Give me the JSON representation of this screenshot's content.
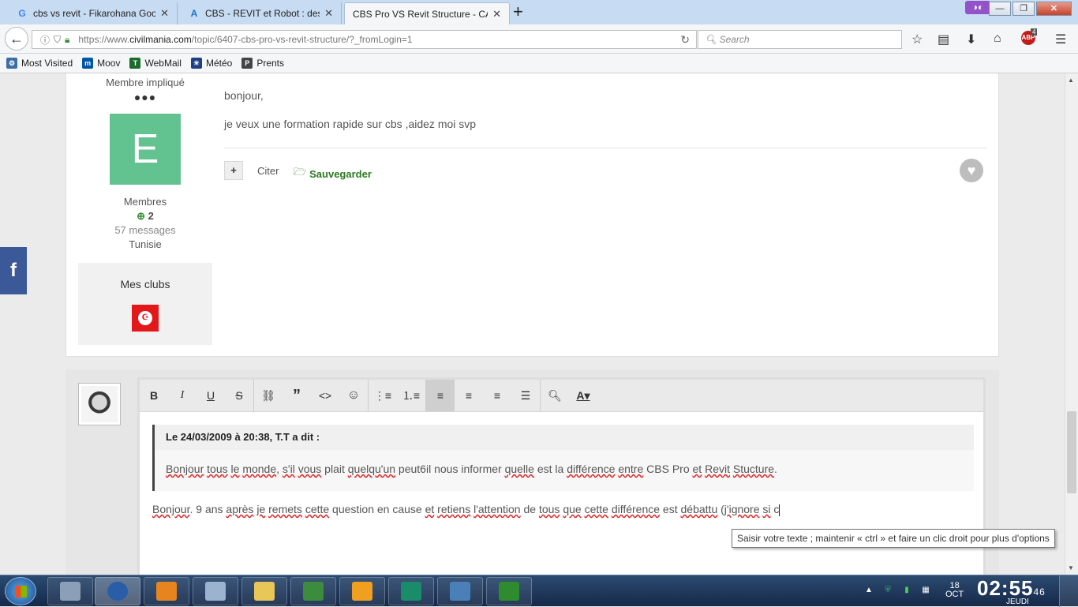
{
  "browser": {
    "tabs": [
      {
        "title": "cbs vs revit - Fikarohana Goo",
        "favicon": "google-icon",
        "color": "#4285f4",
        "glyph": "G"
      },
      {
        "title": "CBS - REVIT et Robot : descen",
        "favicon": "autodesk-icon",
        "color": "#1a73c8",
        "glyph": "A"
      },
      {
        "title": "CBS Pro VS Revit Structure - CAO",
        "favicon": "none",
        "color": "#555555",
        "glyph": ""
      }
    ],
    "new_tab": "+",
    "url_prefix": "https://www.",
    "url_domain": "civilmania.com",
    "url_path": "/topic/6407-cbs-pro-vs-revit-structure/?_fromLogin=1",
    "search_placeholder": "Search",
    "abp_badge": "4",
    "abp_label": "ABP",
    "bookmarks": [
      {
        "label": "Most Visited",
        "color": "#3a6ea5",
        "glyph": "⚙"
      },
      {
        "label": "Moov",
        "color": "#0055a5",
        "glyph": "m"
      },
      {
        "label": "WebMail",
        "color": "#1b6b2e",
        "glyph": "T"
      },
      {
        "label": "Météo",
        "color": "#1d3f87",
        "glyph": "☀"
      },
      {
        "label": "Prents",
        "color": "#444444",
        "glyph": "P"
      }
    ]
  },
  "post": {
    "rank": "Membre impliqué",
    "pips": "●●●",
    "avatar_letter": "E",
    "group": "Membres",
    "reputation": "2",
    "posts_count": "57 messages",
    "country": "Tunisie",
    "clubs_title": "Mes clubs",
    "body_lines": [
      "bonjour,",
      "je veux une formation rapide sur cbs ,aidez moi svp"
    ],
    "quote_action": "Citer",
    "save_action": "Sauvegarder"
  },
  "editor": {
    "quote_header": "Le 24/03/2009 à 20:38, T.T a dit :",
    "quote_body": {
      "segments": [
        {
          "t": "Bonjour",
          "s": true
        },
        {
          "t": " ",
          "s": false
        },
        {
          "t": "tous",
          "s": true
        },
        {
          "t": " ",
          "s": false
        },
        {
          "t": "le",
          "s": true
        },
        {
          "t": " ",
          "s": false
        },
        {
          "t": "monde",
          "s": true
        },
        {
          "t": ", ",
          "s": false
        },
        {
          "t": "s'il",
          "s": true
        },
        {
          "t": " ",
          "s": false
        },
        {
          "t": "vous",
          "s": true
        },
        {
          "t": " plait ",
          "s": false
        },
        {
          "t": "quelqu'un",
          "s": true
        },
        {
          "t": " peut6il nous informer ",
          "s": false
        },
        {
          "t": "quelle",
          "s": true
        },
        {
          "t": " est la ",
          "s": false
        },
        {
          "t": "différence",
          "s": true
        },
        {
          "t": " ",
          "s": false
        },
        {
          "t": "entre",
          "s": true
        },
        {
          "t": " CBS Pro ",
          "s": false
        },
        {
          "t": "et",
          "s": true
        },
        {
          "t": " ",
          "s": false
        },
        {
          "t": "Revit",
          "s": true
        },
        {
          "t": " ",
          "s": false
        },
        {
          "t": "Stucture",
          "s": true
        },
        {
          "t": ".",
          "s": false
        }
      ]
    },
    "reply_text": {
      "segments": [
        {
          "t": "Bonjour",
          "s": true
        },
        {
          "t": ". 9 ans ",
          "s": false
        },
        {
          "t": "après",
          "s": true
        },
        {
          "t": " ",
          "s": false
        },
        {
          "t": "je",
          "s": true
        },
        {
          "t": " ",
          "s": false
        },
        {
          "t": "remets",
          "s": true
        },
        {
          "t": " ",
          "s": false
        },
        {
          "t": "cette",
          "s": true
        },
        {
          "t": " question en cause ",
          "s": false
        },
        {
          "t": "et",
          "s": true
        },
        {
          "t": " ",
          "s": false
        },
        {
          "t": "retiens",
          "s": true
        },
        {
          "t": " ",
          "s": false
        },
        {
          "t": "l'attention",
          "s": true
        },
        {
          "t": " de ",
          "s": false
        },
        {
          "t": "tous",
          "s": true
        },
        {
          "t": " ",
          "s": false
        },
        {
          "t": "que",
          "s": true
        },
        {
          "t": " ",
          "s": false
        },
        {
          "t": "cette",
          "s": true
        },
        {
          "t": " ",
          "s": false
        },
        {
          "t": "différence",
          "s": true
        },
        {
          "t": " est ",
          "s": false
        },
        {
          "t": "débattu",
          "s": true
        },
        {
          "t": " (",
          "s": false
        },
        {
          "t": "j'ignore",
          "s": true
        },
        {
          "t": " ",
          "s": false
        },
        {
          "t": "si",
          "s": true
        },
        {
          "t": " c",
          "s": false
        }
      ]
    },
    "tooltip": "Saisir votre texte ; maintenir « ctrl » et faire un clic droit pour plus d'options"
  },
  "taskbar": {
    "apps": [
      {
        "name": "calculator",
        "color": "#8ba0b8"
      },
      {
        "name": "firefox",
        "color": "#2a5da8",
        "active": true
      },
      {
        "name": "media-player",
        "color": "#e8841e"
      },
      {
        "name": "usb-device",
        "color": "#9bb3cf"
      },
      {
        "name": "file-explorer",
        "color": "#e8c658"
      },
      {
        "name": "task-manager",
        "color": "#3d8c3d"
      },
      {
        "name": "cbs",
        "color": "#f0a020"
      },
      {
        "name": "revit",
        "color": "#1a8c6a"
      },
      {
        "name": "network",
        "color": "#4a7fb8"
      },
      {
        "name": "fichier-app",
        "color": "#2e8b2e"
      }
    ],
    "date_day": "18",
    "date_month": "OCT",
    "time": "02:55",
    "seconds": "46",
    "weekday": "JEUDI"
  }
}
